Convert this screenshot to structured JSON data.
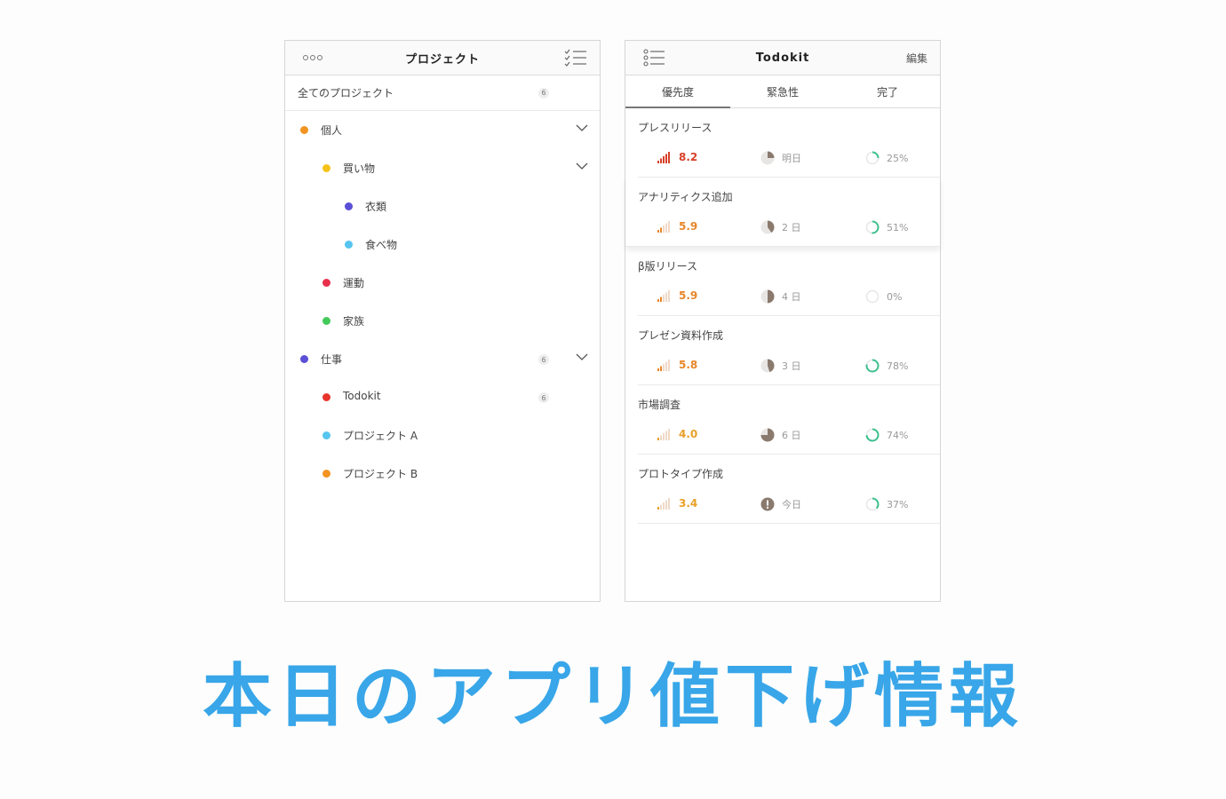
{
  "left": {
    "title": "プロジェクト",
    "all_label": "全てのプロジェクト",
    "all_count": "6",
    "items": [
      {
        "label": "個人",
        "color": "#f29422",
        "indent": 0,
        "chevron": true,
        "count": ""
      },
      {
        "label": "買い物",
        "color": "#f5c219",
        "indent": 1,
        "chevron": true,
        "count": ""
      },
      {
        "label": "衣類",
        "color": "#5a4fd6",
        "indent": 2,
        "chevron": false,
        "count": ""
      },
      {
        "label": "食べ物",
        "color": "#56c5ef",
        "indent": 2,
        "chevron": false,
        "count": ""
      },
      {
        "label": "運動",
        "color": "#e8304c",
        "indent": 1,
        "chevron": false,
        "count": ""
      },
      {
        "label": "家族",
        "color": "#43c95a",
        "indent": 1,
        "chevron": false,
        "count": ""
      },
      {
        "label": "仕事",
        "color": "#5a4fd6",
        "indent": 0,
        "chevron": true,
        "count": "6"
      },
      {
        "label": "Todokit",
        "color": "#e8352c",
        "indent": 1,
        "chevron": false,
        "count": "6"
      },
      {
        "label": "プロジェクト A",
        "color": "#56c5ef",
        "indent": 1,
        "chevron": false,
        "count": ""
      },
      {
        "label": "プロジェクト B",
        "color": "#f29422",
        "indent": 1,
        "chevron": false,
        "count": ""
      }
    ]
  },
  "right": {
    "title": "Todokit",
    "edit_label": "編集",
    "tabs": [
      "優先度",
      "緊急性",
      "完了"
    ],
    "active_tab": 0,
    "tasks": [
      {
        "title": "プレスリリース",
        "priority": "8.2",
        "priority_color": "#d8402a",
        "bars": 5,
        "urgency": "明日",
        "urgency_icon": "pie",
        "urgency_fraction": 0.25,
        "done": "25%",
        "done_fraction": 0.25
      },
      {
        "title": "アナリティクス追加",
        "priority": "5.9",
        "priority_color": "#e8862a",
        "bars": 2,
        "urgency": "2 日",
        "urgency_icon": "pie",
        "urgency_fraction": 0.4,
        "done": "51%",
        "done_fraction": 0.51
      },
      {
        "title": "β版リリース",
        "priority": "5.9",
        "priority_color": "#e8862a",
        "bars": 2,
        "urgency": "4 日",
        "urgency_icon": "pie",
        "urgency_fraction": 0.5,
        "done": "0%",
        "done_fraction": 0.0
      },
      {
        "title": "プレゼン資料作成",
        "priority": "5.8",
        "priority_color": "#e8862a",
        "bars": 2,
        "urgency": "3 日",
        "urgency_icon": "pie",
        "urgency_fraction": 0.45,
        "done": "78%",
        "done_fraction": 0.78
      },
      {
        "title": "市場調査",
        "priority": "4.0",
        "priority_color": "#e8a02a",
        "bars": 1,
        "urgency": "6 日",
        "urgency_icon": "pie",
        "urgency_fraction": 0.75,
        "done": "74%",
        "done_fraction": 0.74
      },
      {
        "title": "プロトタイプ作成",
        "priority": "3.4",
        "priority_color": "#e8a02a",
        "bars": 1,
        "urgency": "今日",
        "urgency_icon": "alert",
        "urgency_fraction": 1.0,
        "done": "37%",
        "done_fraction": 0.37
      }
    ],
    "colors": {
      "bar_inactive": "#f0d9c8",
      "pie_fill": "#8a7a6e",
      "pie_bg": "#e8e6e4",
      "ring": "#3cc08c",
      "ring_bg": "#e6e6e6"
    }
  },
  "banner": "本日のアプリ値下げ情報"
}
